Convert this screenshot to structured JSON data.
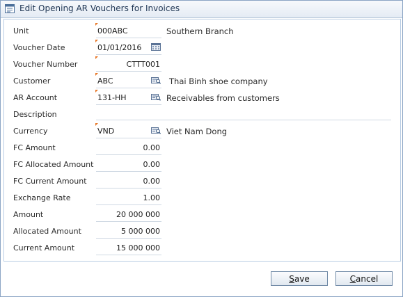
{
  "window": {
    "title": "Edit Opening AR Vouchers for Invoices"
  },
  "form": {
    "unit": {
      "label": "Unit",
      "value": "000ABC",
      "description": "Southern Branch"
    },
    "voucher_date": {
      "label": "Voucher Date",
      "value": "01/01/2016"
    },
    "voucher_number": {
      "label": "Voucher Number",
      "value": "CTTT001"
    },
    "customer": {
      "label": "Customer",
      "value": "ABC",
      "description": "Thai Binh shoe company"
    },
    "ar_account": {
      "label": "AR Account",
      "value": "131-HH",
      "description": "Receivables from customers"
    },
    "description": {
      "label": "Description",
      "value": ""
    },
    "currency": {
      "label": "Currency",
      "value": "VND",
      "description": "Viet Nam Dong"
    },
    "fc_amount": {
      "label": "FC Amount",
      "value": "0.00"
    },
    "fc_allocated_amount": {
      "label": "FC Allocated Amount",
      "value": "0.00"
    },
    "fc_current_amount": {
      "label": "FC Current Amount",
      "value": "0.00"
    },
    "exchange_rate": {
      "label": "Exchange Rate",
      "value": "1.00"
    },
    "amount": {
      "label": "Amount",
      "value": "20 000 000"
    },
    "allocated_amount": {
      "label": "Allocated Amount",
      "value": "5 000 000"
    },
    "current_amount": {
      "label": "Current Amount",
      "value": "15 000 000"
    }
  },
  "buttons": {
    "save": {
      "mnemonic": "S",
      "rest": "ave"
    },
    "cancel": {
      "mnemonic": "C",
      "rest": "ancel"
    }
  },
  "icons": {
    "title": "edit-form-icon",
    "calendar": "calendar-icon",
    "lookup": "lookup-icon"
  },
  "colors": {
    "required_marker": "#e8792a",
    "accent_border": "#8aa4c4"
  }
}
